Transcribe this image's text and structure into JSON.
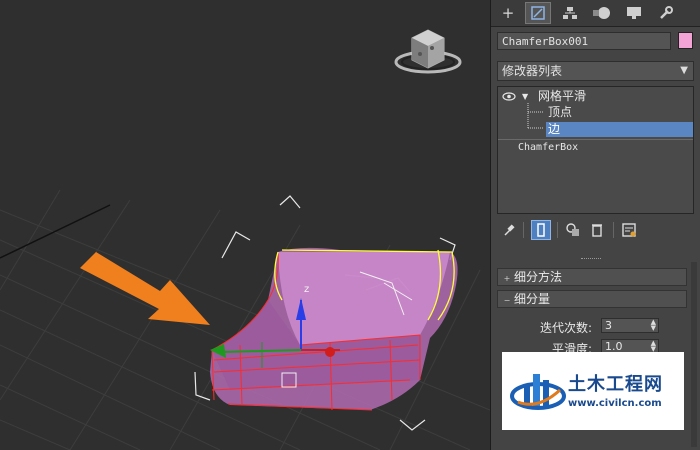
{
  "panel": {
    "object_name": "ChamferBox001",
    "object_color": "#f3a3d6",
    "modifier_list_label": "修改器列表",
    "stack": {
      "modifier": "网格平滑",
      "sub_vertex": "顶点",
      "sub_edge": "边",
      "base_object": "ChamferBox"
    },
    "rollouts": {
      "subdivision_method": "细分方法",
      "subdivision_amount": "细分量",
      "iterations_label": "迭代次数:",
      "iterations_value": "3",
      "smoothness_label": "平滑度:",
      "smoothness_value": "1.0"
    }
  },
  "viewport": {
    "gizmo_z_label": "z",
    "viewcube_accent": "#cccccc",
    "arrow_color": "#f07f1e",
    "mesh_color": "#c97ac9",
    "wire_color": "#ff2a2a",
    "select_edge_color": "#ffff40"
  },
  "watermark": {
    "brand": "土木工程网",
    "url": "www.civilcn.com"
  },
  "icons": [
    "create-icon",
    "modify-icon",
    "hierarchy-icon",
    "motion-icon",
    "display-icon",
    "utilities-icon",
    "pin-stack-icon",
    "show-end-result-icon",
    "make-unique-icon",
    "remove-modifier-icon",
    "configure-sets-icon",
    "eye-icon"
  ]
}
